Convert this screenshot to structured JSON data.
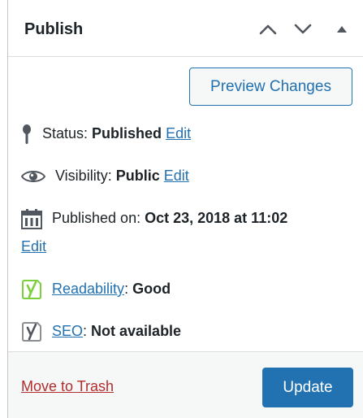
{
  "header": {
    "title": "Publish",
    "icons": [
      "chevron-up-icon",
      "chevron-down-icon",
      "triangle-up-icon"
    ]
  },
  "actions": {
    "preview_label": "Preview Changes",
    "update_label": "Update",
    "trash_label": "Move to Trash"
  },
  "status": {
    "icon": "pin-icon",
    "label": "Status: ",
    "value": "Published",
    "edit": "Edit"
  },
  "visibility": {
    "icon": "eye-icon",
    "label": "Visibility: ",
    "value": "Public",
    "edit": "Edit"
  },
  "published": {
    "icon": "calendar-icon",
    "label": "Published on: ",
    "value": "Oct 23, 2018 at 11:02",
    "edit": "Edit"
  },
  "readability": {
    "icon": "yoast-green-icon",
    "link": "Readability",
    "separator": ": ",
    "value": "Good"
  },
  "seo": {
    "icon": "yoast-gray-icon",
    "link": "SEO",
    "separator": ": ",
    "value": "Not available"
  },
  "colors": {
    "primary": "#2271b1",
    "danger": "#b32d2e",
    "yoast_good": "#7ad03a",
    "text": "#1d2327",
    "muted_icon": "#8c8f94"
  }
}
